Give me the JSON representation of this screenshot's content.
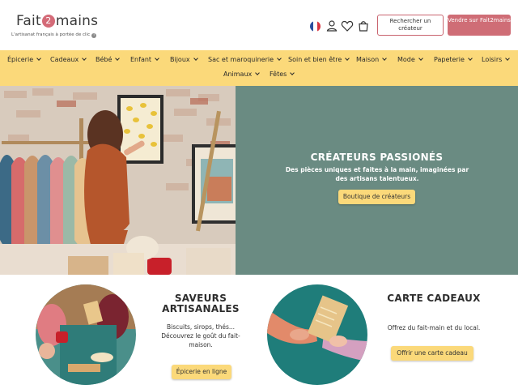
{
  "header": {
    "logo_left": "Fait",
    "logo_num": "2",
    "logo_right": "mains",
    "tagline": "L'artisanat français à portée de clic",
    "search_creator_label": "Rechercher un créateur",
    "sell_label": "Vendre sur Fait2mains"
  },
  "nav": {
    "row1": [
      "Épicerie",
      "Cadeaux",
      "Bébé",
      "Enfant",
      "Bijoux",
      "Sac et maroquinerie",
      "Soin et bien être",
      "Maison",
      "Mode",
      "Papeterie",
      "Loisirs"
    ],
    "row2": [
      "Animaux",
      "Fêtes"
    ]
  },
  "hero": {
    "title": "CRÉATEURS PASSIONÉS",
    "subtitle": "Des pièces uniques et faites à la main, imaginées par des artisans talentueux.",
    "button": "Boutique de créateurs",
    "poster_text": "IL N'Y A PAS DE RÊVE TROP GRAND"
  },
  "cards": [
    {
      "title": "SAVEURS ARTISANALES",
      "text": "Biscuits, sirops, thés... Découvrez le goût du fait-maison.",
      "button": "Épicerie en ligne"
    },
    {
      "title": "CARTE CADEAUX",
      "text": "Offrez du fait-main et du local.",
      "button": "Offrir une carte cadeau"
    }
  ],
  "colors": {
    "accent_pink": "#cf6d76",
    "nav_yellow": "#fbd97a",
    "hero_green": "#6a8b82"
  }
}
